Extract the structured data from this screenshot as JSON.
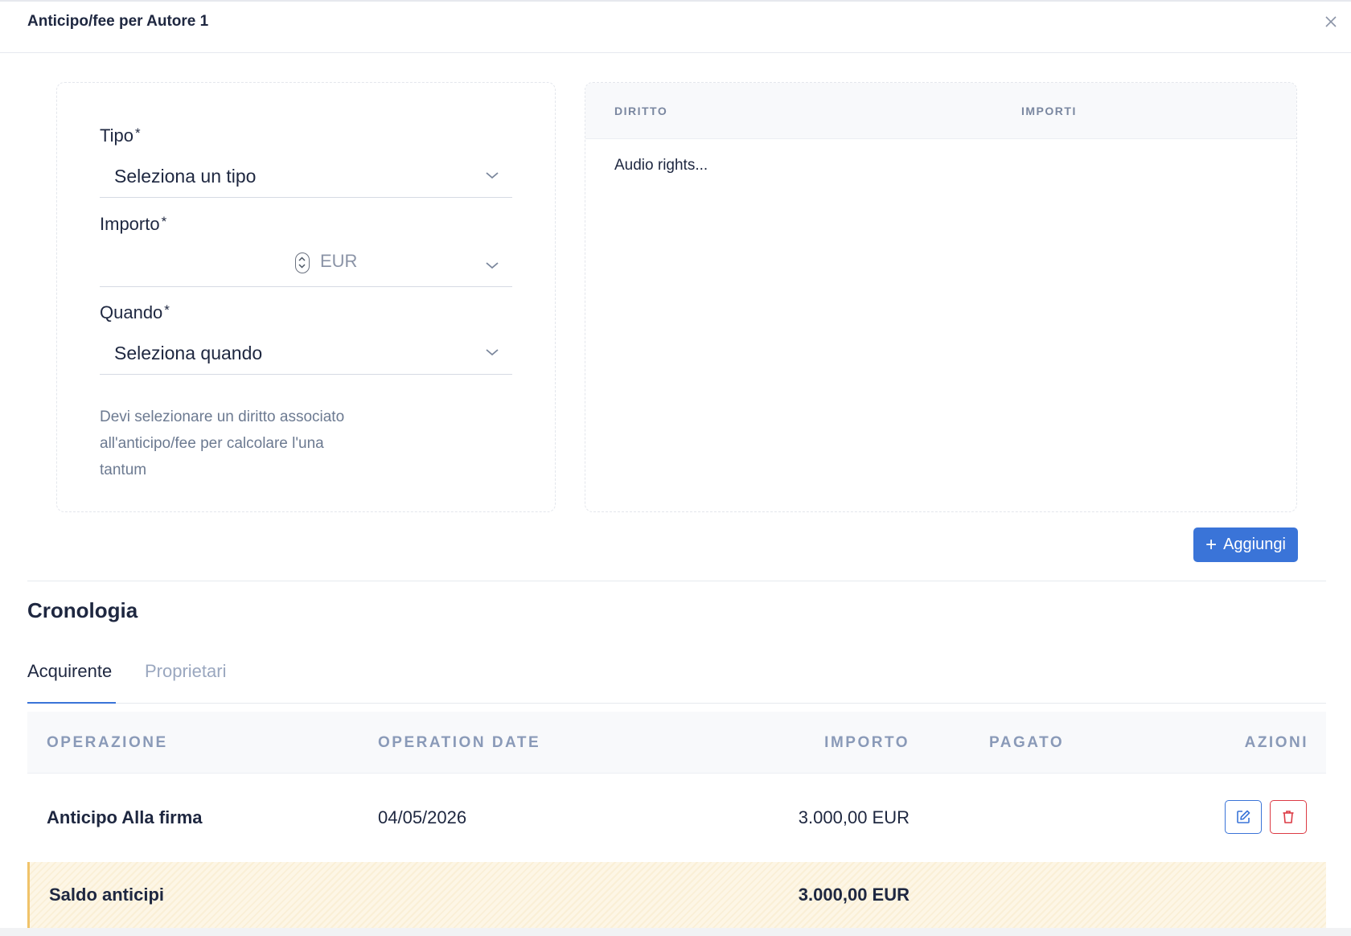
{
  "header": {
    "title": "Anticipo/fee per Autore 1"
  },
  "form": {
    "tipo": {
      "label": "Tipo",
      "required_mark": "*",
      "value": "Seleziona un tipo"
    },
    "importo": {
      "label": "Importo",
      "required_mark": "*",
      "currency": "EUR"
    },
    "quando": {
      "label": "Quando",
      "required_mark": "*",
      "value": "Seleziona quando"
    },
    "hint": "Devi selezionare un diritto associato all'anticipo/fee per calcolare l'una tantum"
  },
  "rights_table": {
    "headers": [
      "DIRITTO",
      "IMPORTI"
    ],
    "rows": [
      {
        "diritto": "Audio rights..."
      }
    ]
  },
  "add_button": {
    "label": "Aggiungi"
  },
  "history": {
    "title": "Cronologia",
    "tabs": [
      {
        "label": "Acquirente",
        "active": true
      },
      {
        "label": "Proprietari",
        "active": false
      }
    ],
    "columns": [
      "OPERAZIONE",
      "OPERATION DATE",
      "IMPORTO",
      "PAGATO",
      "AZIONI"
    ],
    "rows": [
      {
        "operazione": "Anticipo Alla firma",
        "date": "04/05/2026",
        "importo": "3.000,00 EUR",
        "pagato": ""
      }
    ],
    "summary": {
      "label": "Saldo anticipi",
      "importo": "3.000,00 EUR"
    }
  },
  "colors": {
    "accent": "#3a74d8",
    "danger": "#dc3b45",
    "summary_bg": "#fdf6e6"
  }
}
